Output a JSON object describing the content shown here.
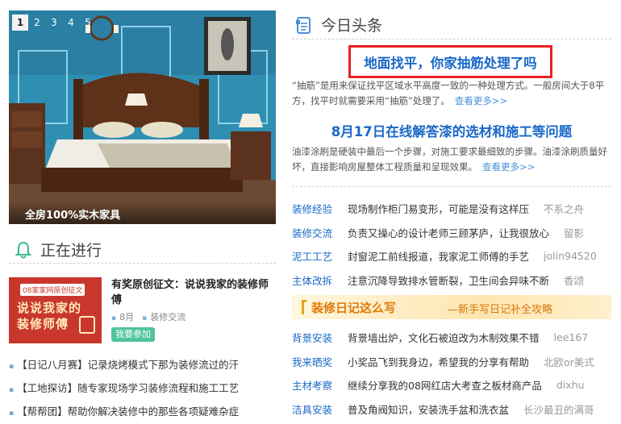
{
  "slider": {
    "dots": [
      "1",
      "2",
      "3",
      "4",
      "5"
    ],
    "active_index": 0,
    "caption": "全房100%实木家具"
  },
  "in_progress": {
    "title": "正在进行",
    "feature": {
      "thumb_tag": "08家家网原创征文",
      "thumb_text_1": "说说我家的",
      "thumb_text_2": "装修师傅",
      "title": "有奖原创征文：说说我家的装修师傅",
      "meta_month": "8月",
      "meta_category": "装修交流",
      "join_label": "我要参加"
    },
    "list": [
      "【日记八月赛】记录烧烤模式下那为装修流过的汗",
      "【工地探访】随专家现场学习装修流程和施工工艺",
      "【帮帮团】帮助你解决装修中的那些各项疑难杂症"
    ]
  },
  "news": {
    "title": "今日头条",
    "headline1": "地面找平，你家抽筋处理了吗",
    "summary1": "“抽筋”是用来保证找平区域水平高度一致的一种处理方式。一般房间大于8平方，找平时就需要采用“抽筋”处理了。",
    "more1": "查看更多>>",
    "headline2": "8月17日在线解答漆的选材和施工等问题",
    "summary2": "油漆涂刷是硬装中最后一个步骤，对施工要求最细致的步骤。油漆涂刷质量好坏，直接影响房屋整体工程质量和呈现效果。",
    "more2": "查看更多>>",
    "rows_a": [
      {
        "cat": "装修经验",
        "title": "现场制作柜门易变形，可能是没有这样压",
        "author": "不系之舟"
      },
      {
        "cat": "装修交流",
        "title": "负责又操心的设计老师三顾茅庐，让我很放心",
        "author": "留影"
      },
      {
        "cat": "泥工工艺",
        "title": "封窗泥工前线报道，我家泥工师傅的手艺",
        "author": "jolin94520"
      },
      {
        "cat": "主体改拆",
        "title": "注意沉降导致排水管断裂，卫生间会异味不断",
        "author": "香颂"
      }
    ],
    "diary_banner": {
      "main": "装修日记这么写",
      "sub": "—新手写日记补全攻略"
    },
    "rows_b": [
      {
        "cat": "背景安装",
        "title": "背景墙出炉，文化石被迫改为木制效果不错",
        "author": "lee167"
      },
      {
        "cat": "我来晒奖",
        "title": "小奖品飞到我身边，希望我的分享有帮助",
        "author": "北欧or美式"
      },
      {
        "cat": "主材考察",
        "title": "继续分享我的08网红店大考查之板材商产品",
        "author": "dixhu"
      },
      {
        "cat": "洁具安装",
        "title": "普及角阀知识，安装洗手盆和洗衣盆",
        "author": "长沙最丑的满哥"
      }
    ]
  }
}
